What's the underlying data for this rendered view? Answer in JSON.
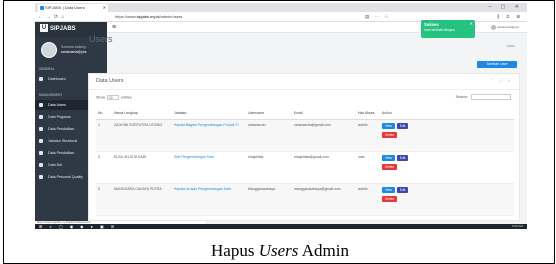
{
  "browser": {
    "tab_title": "SIPJABS | Data Users",
    "url_prefix": "https://www.",
    "url_domain": "sipjabs.my.id",
    "url_path": "/admin/users",
    "window_controls": "– ▢ ✕"
  },
  "sidebar": {
    "brand": "SIPJABS",
    "logo": "U",
    "user_status": "Selamat datang",
    "user_name": "sahamarta@yes",
    "sections": [
      "GENERAL",
      "MANAGEMENT"
    ],
    "items": [
      {
        "label": "Dashboard"
      },
      {
        "label": "Data Users"
      },
      {
        "label": "Data Pegawai"
      },
      {
        "label": "Data Pendidikan"
      },
      {
        "label": "Jabatan Struktural"
      },
      {
        "label": "Data Pendidikan"
      },
      {
        "label": "Data Diri"
      },
      {
        "label": "Data Personal Quality"
      }
    ]
  },
  "header": {
    "user": "sahamarta@yes"
  },
  "page": {
    "title": "Users",
    "breadcrumb": "Users",
    "add_button": "Tambah User"
  },
  "toast": {
    "title": "Sukses",
    "message": "User berhasil dihapus"
  },
  "panel": {
    "title": "Data Users",
    "show_label": "Show",
    "show_value": "10",
    "entries_label": "entries",
    "search_label": "Search:"
  },
  "table": {
    "columns": [
      "No",
      "Nama Lengkap",
      "Jabatan",
      "Username",
      "Email",
      "Hak Akses",
      "Action"
    ],
    "rows": [
      {
        "no": "1",
        "nama": "ZAGHINI SOEPUTRA UTOMO",
        "jabatan": "Kepala Bagian Pengembangan Produk TI",
        "username": "zahanarutu",
        "email": "zahanarutu@gmail.com",
        "akses": "admin"
      },
      {
        "no": "2",
        "nama": "ELSA JELISTA SARI",
        "jabatan": "Staf Pengembangan Karir",
        "username": "elsajelista",
        "email": "elsajelista@gmail.com",
        "akses": "user"
      },
      {
        "no": "3",
        "nama": "MANGGARA CAHAYA PUTRA",
        "jabatan": "Kepala Urusan Pengembangan Karir",
        "username": "Manggaracahaya",
        "email": "manggaracahaya@gmail.com",
        "akses": "admin"
      }
    ],
    "view_label": "View",
    "edit_label": "Edit",
    "delete_label": "Delete"
  },
  "statusbar": {
    "text": "https://www.sipjabs.my.id/admin/datauser/3"
  },
  "taskbar": {
    "time": "5:02 AM"
  },
  "caption": {
    "prefix": "Hapus ",
    "italic": "Users",
    "suffix": " Admin"
  },
  "colors": {
    "sidebar": "#2f3945",
    "accent": "#1e88e5",
    "success": "#26c281",
    "danger": "#e53935"
  }
}
